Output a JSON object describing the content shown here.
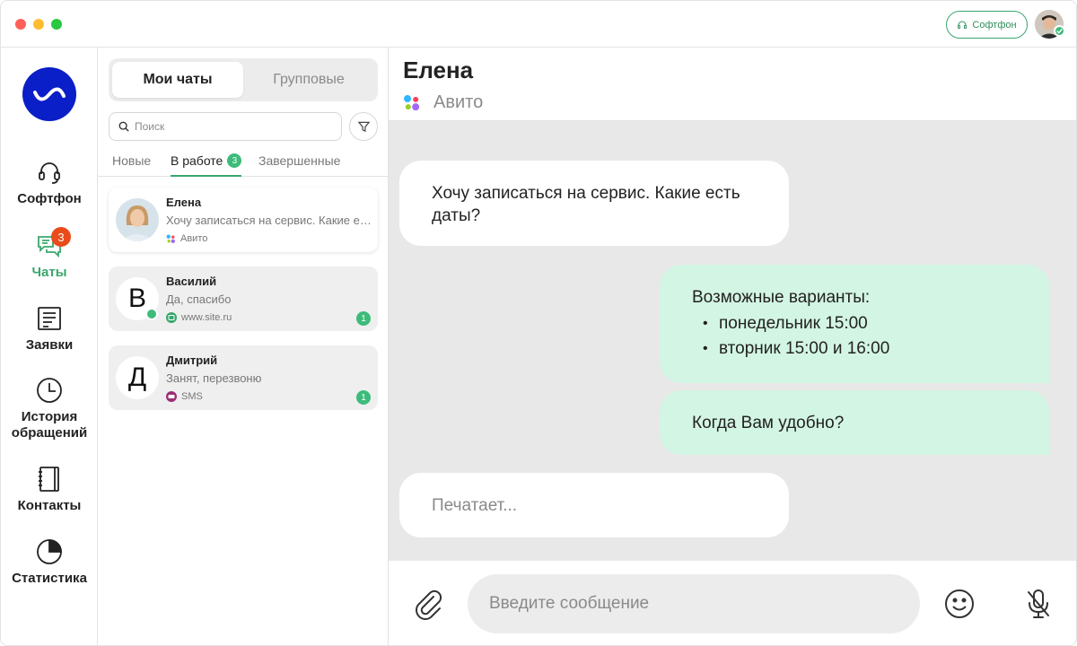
{
  "topbar": {
    "softphone_label": "Софтфон"
  },
  "nav": {
    "items": [
      {
        "label": "Софтфон"
      },
      {
        "label": "Чаты",
        "badge": "3"
      },
      {
        "label": "Заявки"
      },
      {
        "label": "История обращений"
      },
      {
        "label": "Контакты"
      },
      {
        "label": "Статистика"
      }
    ],
    "accent_color": "#3aa76d",
    "logo_color": "#0a1fc7"
  },
  "chatlist": {
    "segments": [
      "Мои чаты",
      "Групповые"
    ],
    "search_placeholder": "Поиск",
    "tabs": [
      {
        "label": "Новые"
      },
      {
        "label": "В работе",
        "badge": "3"
      },
      {
        "label": "Завершенные"
      }
    ],
    "chats": [
      {
        "name": "Елена",
        "message": "Хочу записаться на сервис. Какие есть даты?",
        "source": "Авито",
        "source_icon": "avito-icon"
      },
      {
        "name": "Василий",
        "initial": "В",
        "message": "Да, спасибо",
        "source": "www.site.ru",
        "source_icon": "web-chat-icon",
        "unread": "1"
      },
      {
        "name": "Дмитрий",
        "initial": "Д",
        "message": "Занят, перезвоню",
        "source": "SMS",
        "source_icon": "sms-icon",
        "unread": "1"
      }
    ]
  },
  "conversation": {
    "name": "Елена",
    "source": "Авито",
    "messages": [
      {
        "direction": "in",
        "text": "Хочу записаться на сервис. Какие есть даты?"
      },
      {
        "direction": "out",
        "text": "Возможные варианты:",
        "list": [
          "понедельник 15:00",
          "вторник 15:00 и 16:00"
        ]
      },
      {
        "direction": "out",
        "text": "Когда Вам удобно?"
      }
    ],
    "typing_text": "Печатает...",
    "input_placeholder": "Введите сообщение",
    "outgoing_color": "#d3f5e3"
  }
}
